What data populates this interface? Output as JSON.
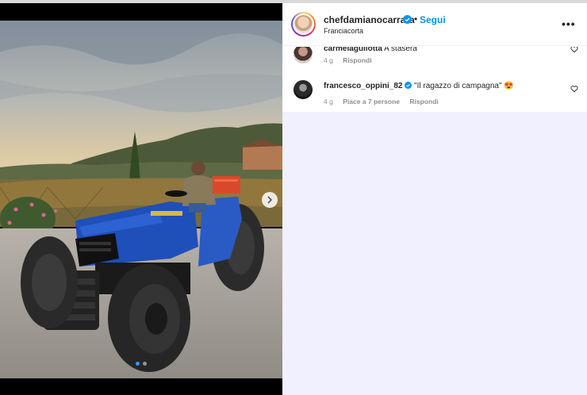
{
  "post": {
    "username": "chefdamianocarrara",
    "separator": "•",
    "follow_label": "Segui",
    "location": "Franciacorta",
    "more_label": "•••"
  },
  "media": {
    "description": "",
    "carousel_total": 2,
    "carousel_active": 1
  },
  "comments": [
    {
      "username": "carmelaguliotta",
      "text": "A stasera",
      "age": "4 g",
      "likes": "",
      "reply_label": "Rispondi"
    },
    {
      "username": "francesco_oppini_82",
      "text": "\"Il ragazzo di campagna\" 😍",
      "age": "4 g",
      "likes": "Piace a 7 persone",
      "reply_label": "Rispondi"
    }
  ],
  "colors": {
    "accent": "#0095f6",
    "panel_bg": "#f1f0fe",
    "tractor_blue": "#1f4fb8"
  }
}
